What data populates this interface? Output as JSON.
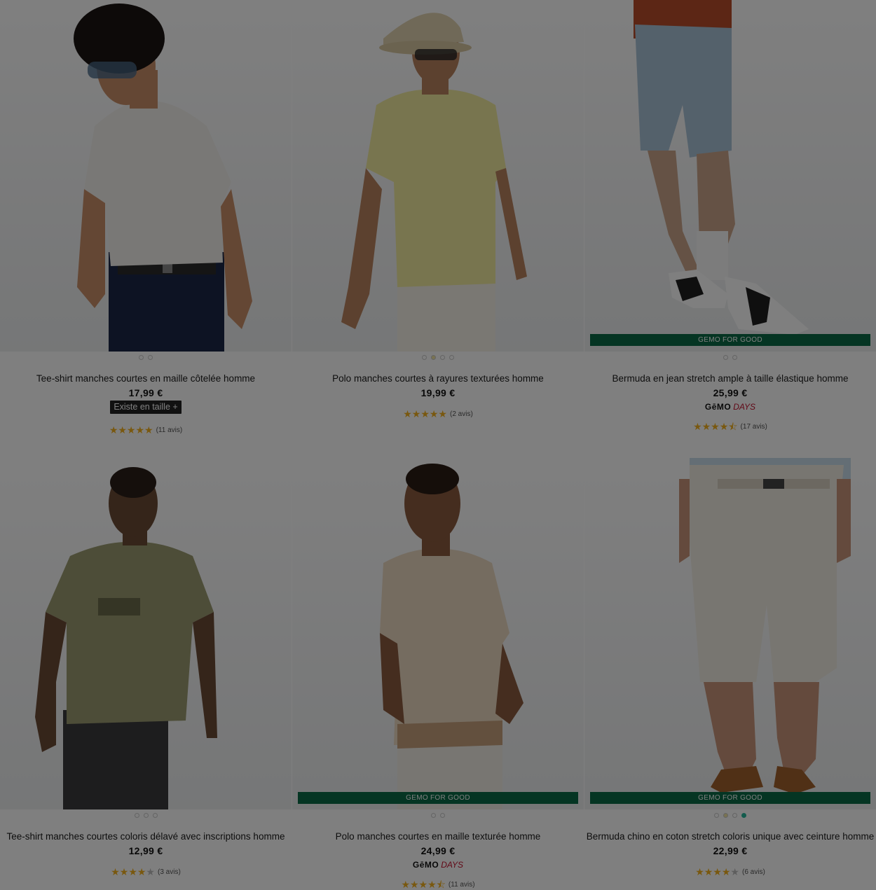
{
  "products": [
    {
      "title": "Tee-shirt manches courtes en maille côtelée homme",
      "price": "17,99 €",
      "sizes_label": "Existe en taille +",
      "stars": "★★★★★",
      "stars_off": "",
      "reviews": "(11 avis)",
      "swatches": 2
    },
    {
      "title": "Polo manches courtes à rayures texturées homme",
      "price": "19,99 €",
      "stars": "★★★★★",
      "stars_off": "",
      "reviews": "(2 avis)",
      "swatches": 4
    },
    {
      "title": "Bermuda en jean stretch ample à taille élastique homme",
      "price": "25,99 €",
      "badge": "GEMO FOR GOOD",
      "logo_gemo": "GēMO",
      "logo_days": "DAYS",
      "stars": "★★★★⯪",
      "stars_off": "",
      "reviews": "(17 avis)",
      "swatches": 2
    },
    {
      "title": "Tee-shirt manches courtes coloris délavé avec inscriptions homme",
      "price": "12,99 €",
      "stars": "★★★★",
      "stars_off": "★",
      "reviews": "(3 avis)",
      "swatches": 3
    },
    {
      "title": "Polo manches courtes en maille texturée homme",
      "price": "24,99 €",
      "badge": "GEMO FOR GOOD",
      "logo_gemo": "GēMO",
      "logo_days": "DAYS",
      "stars": "★★★★⯪",
      "stars_off": "",
      "reviews": "(11 avis)",
      "swatches": 2
    },
    {
      "title": "Bermuda chino en coton stretch coloris unique avec ceinture homme",
      "price": "22,99 €",
      "badge": "GEMO FOR GOOD",
      "stars": "★★★★",
      "stars_off": "★",
      "reviews": "(6 avis)",
      "swatches": 4
    }
  ],
  "colors": {
    "badge_green": "#0b6b46",
    "star_gold": "#f2b01e",
    "days_red": "#c2102d",
    "overlay": "rgba(0,0,0,0.5)"
  }
}
